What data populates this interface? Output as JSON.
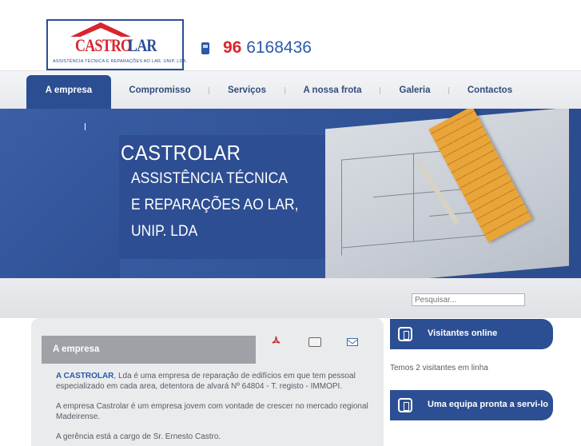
{
  "header": {
    "logo_name_part1": "CASTRO",
    "logo_name_part2": "LAR",
    "logo_subtitle": "ASSISTÊNCIA TÉCNICA E REPARAÇÕES AO LAR, UNIP. LDA.",
    "phone_prefix": "96",
    "phone_number": "6168436"
  },
  "nav": {
    "items": [
      {
        "label": "A empresa",
        "active": true
      },
      {
        "label": "Compromisso",
        "active": false
      },
      {
        "label": "Serviços",
        "active": false
      },
      {
        "label": "A nossa frota",
        "active": false
      },
      {
        "label": "Galeria",
        "active": false
      },
      {
        "label": "Contactos",
        "active": false
      }
    ]
  },
  "banner": {
    "title": "CASTROLAR",
    "lines": [
      "ASSISTÊNCIA TÉCNICA",
      "E REPARAÇÕES AO LAR,",
      "UNIP. LDA"
    ]
  },
  "search": {
    "placeholder": "Pesquisar..."
  },
  "main": {
    "title": "A empresa",
    "icons": [
      "pdf-icon",
      "print-icon",
      "email-icon"
    ],
    "paragraphs": [
      {
        "highlight": "A CASTROLAR",
        "text": ", Lda é uma empresa de reparação de edifícios em que tem pessoal especializado em cada area, detentora de alvará Nº 64804 - T. registo - IMMOPI."
      },
      {
        "highlight": "",
        "text": "A empresa Castrolar é um empresa jovem com vontade de crescer no mercado regional Madeirense."
      },
      {
        "highlight": "",
        "text": "A gerência está a cargo de Sr. Ernesto Castro."
      }
    ]
  },
  "sidebar": {
    "visitors_title": "Visitantes online",
    "visitors_text": "Temos 2 visitantes em linha",
    "team_title": "Uma equipa pronta a servi-lo"
  },
  "colors": {
    "brand_blue": "#2c4f93",
    "brand_red": "#d8262f",
    "nav_text": "#334b7a"
  }
}
